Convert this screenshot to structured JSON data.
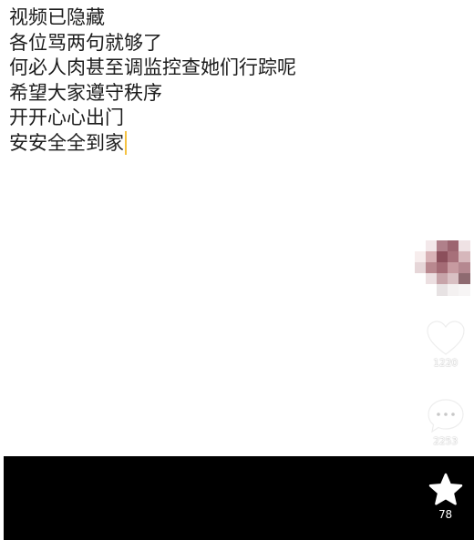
{
  "caption": {
    "lines": [
      "视频已隐藏",
      "各位骂两句就够了",
      "何必人肉甚至调监控查她们行踪呢",
      "希望大家遵守秩序",
      "开开心心出门",
      "安安全全到家"
    ]
  },
  "actions": {
    "like": {
      "icon": "heart-icon",
      "count": "1220"
    },
    "comment": {
      "icon": "comment-bubble-icon",
      "count": "2253"
    },
    "favorite": {
      "icon": "star-icon",
      "count": "78"
    }
  },
  "colors": {
    "cursor": "#f5c242",
    "bottom_bar": "#000000",
    "text": "#1c1c1c"
  }
}
